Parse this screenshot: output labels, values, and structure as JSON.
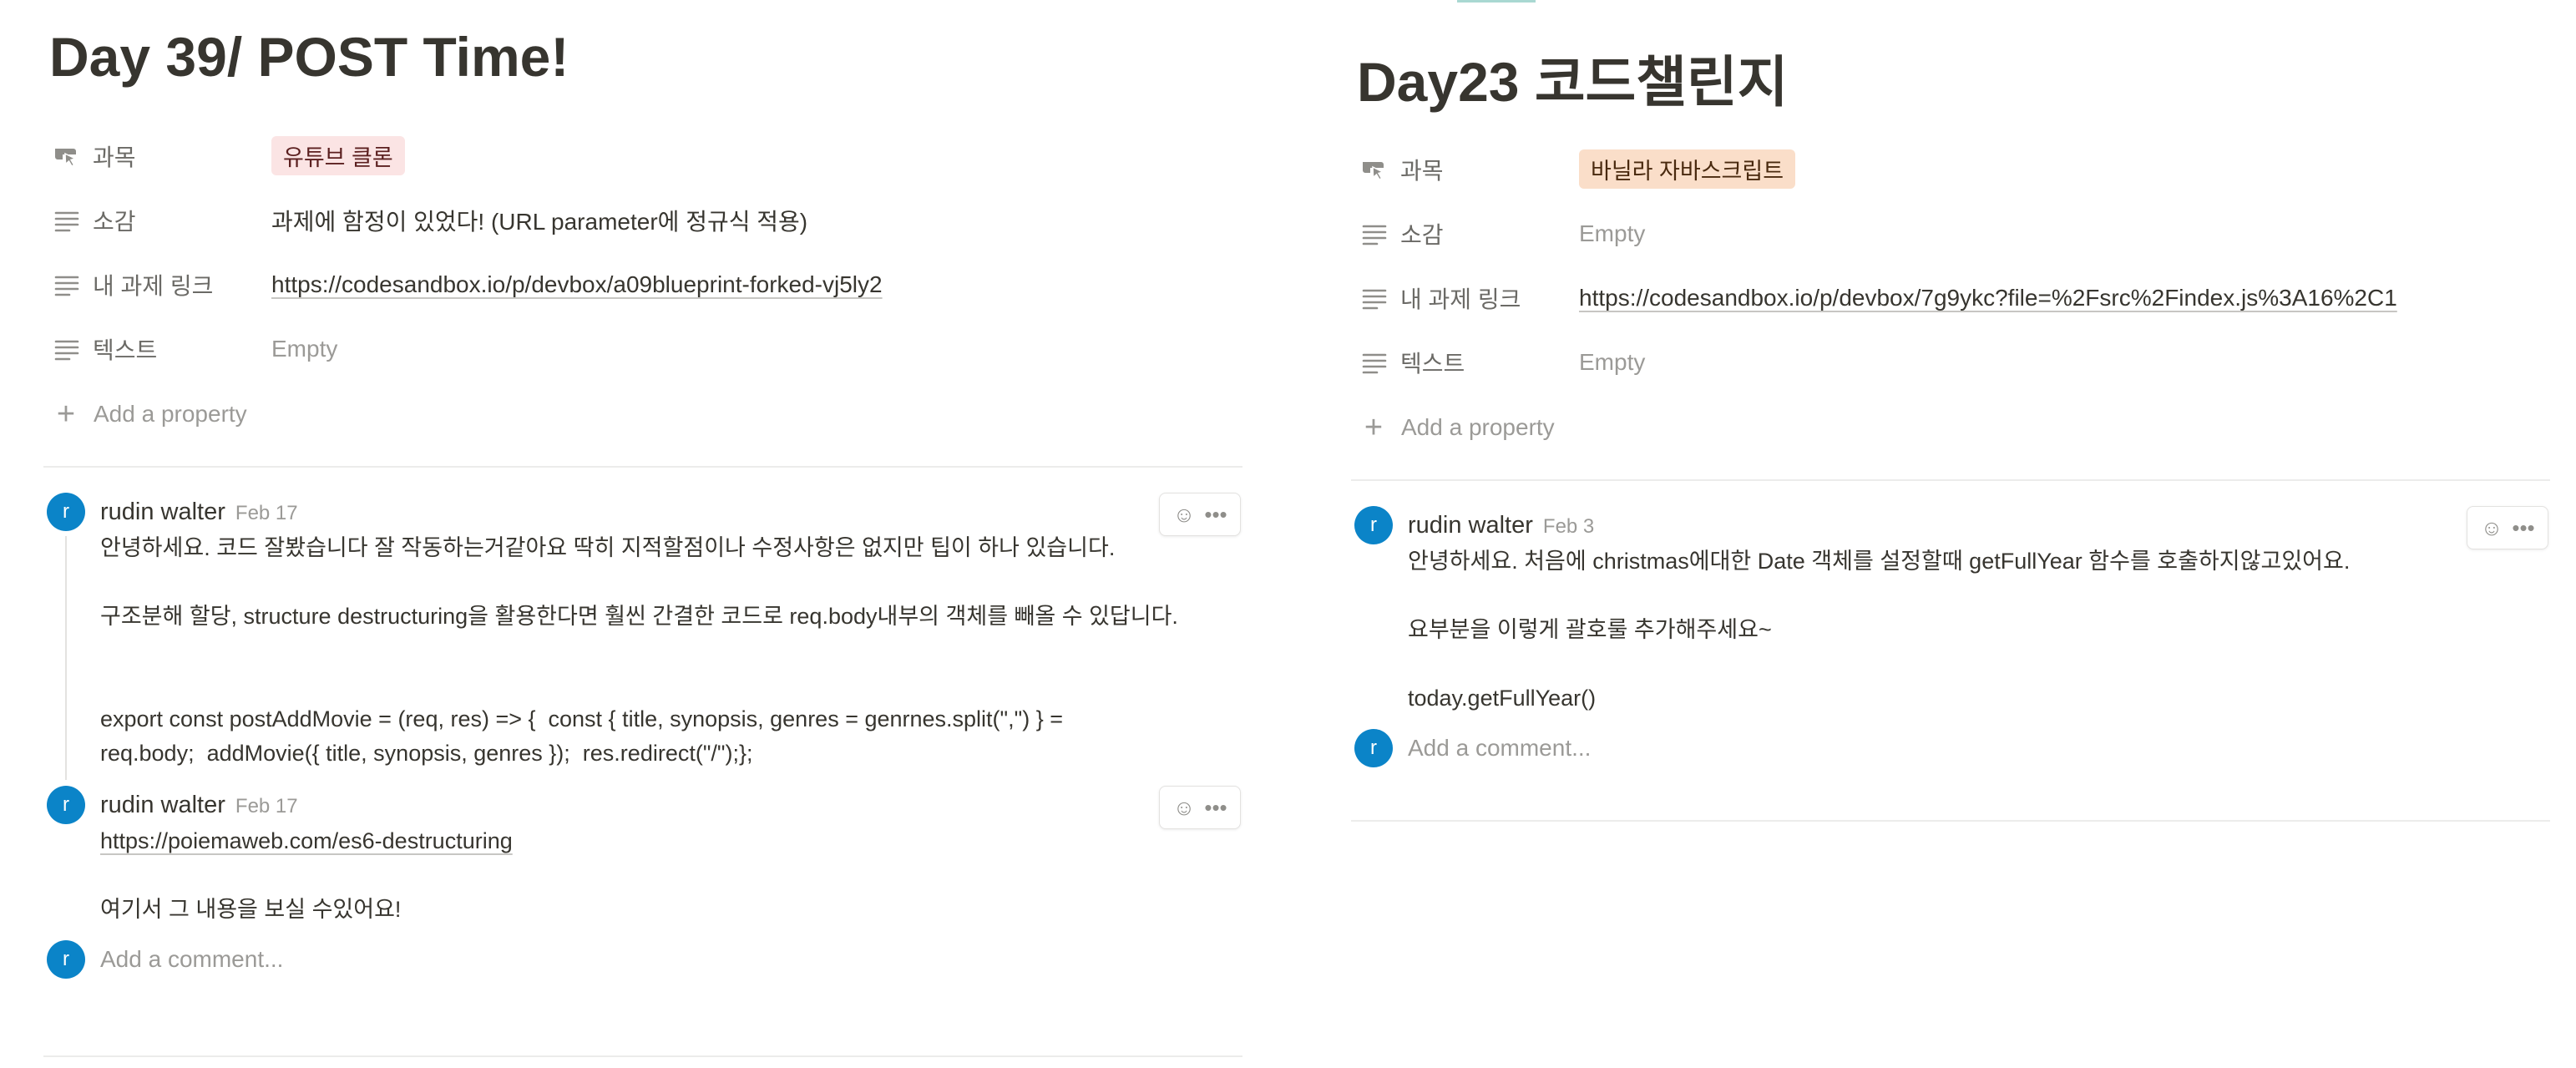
{
  "left": {
    "title": "Day 39/ POST Time!",
    "properties": [
      {
        "key": "과목",
        "icon": "cursor-multiselect-icon",
        "value": "유튜브 클론",
        "type": "tag"
      },
      {
        "key": "소감",
        "icon": "text-lines-icon",
        "value": "과제에 함정이 있었다!  (URL parameter에 정규식 적용)",
        "type": "text"
      },
      {
        "key": "내 과제 링크",
        "icon": "text-lines-icon",
        "value": "https://codesandbox.io/p/devbox/a09blueprint-forked-vj5ly2",
        "type": "link"
      },
      {
        "key": "텍스트",
        "icon": "text-lines-icon",
        "value": "Empty",
        "type": "empty"
      }
    ],
    "add_property": "Add a property",
    "comments": [
      {
        "avatar": "r",
        "author": "rudin walter",
        "date": "Feb 17",
        "lines": [
          "안녕하세요. 코드 잘봤습니다 잘 작동하는거같아요 딱히 지적할점이나 수정사항은 없지만 팁이 하나 있습니다.",
          "",
          "구조분해 할당, structure destructuring을 활용한다면 훨씬 간결한 코드로 req.body내부의 객체를 빼올 수 있답니다.",
          "",
          "",
          "export const postAddMovie = (req, res) => {  const { title, synopsis, genres = genrnes.split(\",\") } =",
          "req.body;  addMovie({ title, synopsis, genres });  res.redirect(\"/\");};"
        ]
      },
      {
        "avatar": "r",
        "author": "rudin walter",
        "date": "Feb 17",
        "link": "https://poiemaweb.com/es6-destructuring",
        "lines": [
          "",
          "여기서 그 내용을 보실 수있어요!"
        ]
      }
    ],
    "add_comment_placeholder": "Add a comment..."
  },
  "right": {
    "title": "Day23 코드챌린지",
    "properties": [
      {
        "key": "과목",
        "icon": "cursor-multiselect-icon",
        "value": "바닐라 자바스크립트",
        "type": "tag"
      },
      {
        "key": "소감",
        "icon": "text-lines-icon",
        "value": "Empty",
        "type": "empty"
      },
      {
        "key": "내 과제 링크",
        "icon": "text-lines-icon",
        "value": "https://codesandbox.io/p/devbox/7g9ykc?file=%2Fsrc%2Findex.js%3A16%2C1",
        "type": "link"
      },
      {
        "key": "텍스트",
        "icon": "text-lines-icon",
        "value": "Empty",
        "type": "empty"
      }
    ],
    "add_property": "Add a property",
    "comments": [
      {
        "avatar": "r",
        "author": "rudin walter",
        "date": "Feb 3",
        "lines": [
          "안녕하세요. 처음에 christmas에대한 Date 객체를 설정할때 getFullYear 함수를 호출하지않고있어요.",
          "",
          "요부분을 이렇게 괄호룰 추가해주세요~",
          "",
          "today.getFullYear()"
        ]
      }
    ],
    "add_comment_placeholder": "Add a comment..."
  },
  "colors": {
    "avatar": "#0b84c8",
    "tag_pink": "#fbe4e4",
    "tag_orange": "#fadec9"
  }
}
